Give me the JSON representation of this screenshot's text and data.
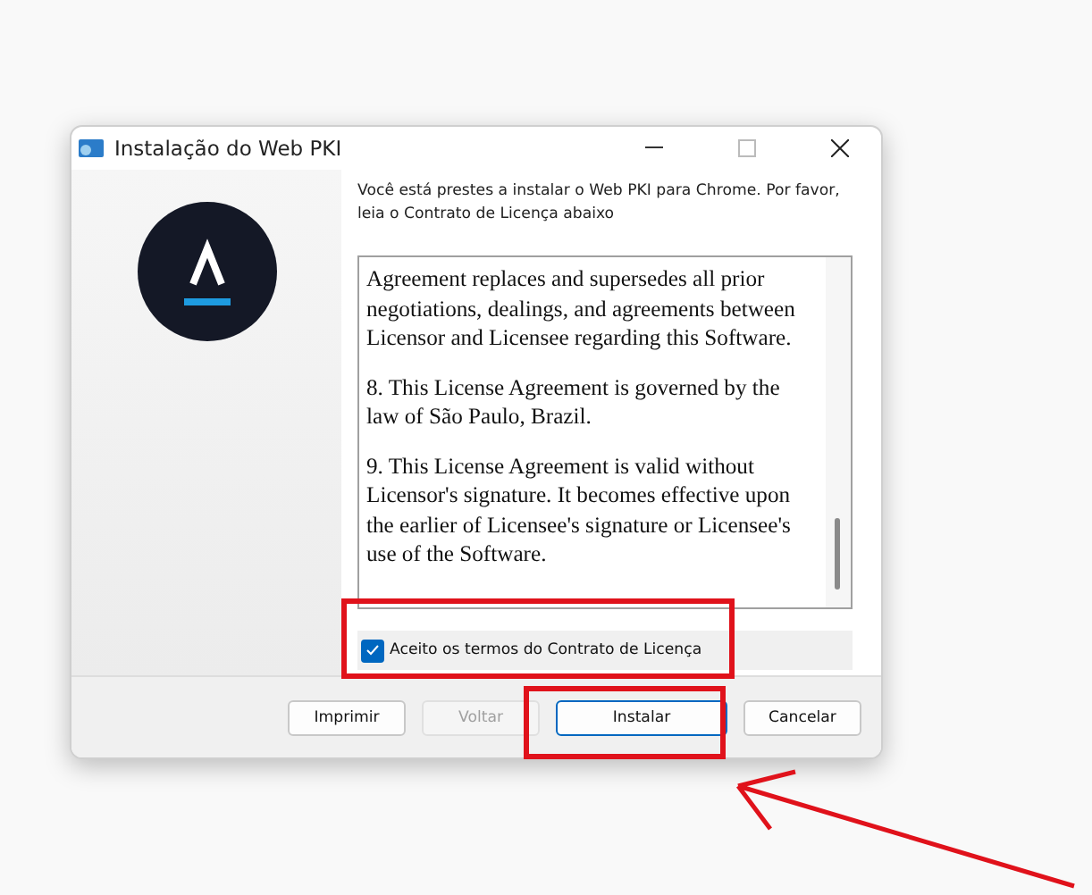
{
  "window": {
    "title": "Instalação do Web PKI"
  },
  "intro": "Você está prestes a instalar o Web PKI para Chrome. Por favor, leia o Contrato de Licença abaixo",
  "license_paragraphs": [
    "Agreement replaces and supersedes all prior negotiations, dealings, and agreements between Licensor and Licensee regarding this Software.",
    "8. This License Agreement is governed by the law of São Paulo, Brazil.",
    "9. This License Agreement is valid without Licensor's signature. It becomes effective upon the earlier of Licensee's signature or Licensee's use of the Software."
  ],
  "accept": {
    "label": "Aceito os termos do Contrato de Licença",
    "checked": true
  },
  "buttons": [
    {
      "label": "Imprimir",
      "disabled": false,
      "focused": false
    },
    {
      "label": "Voltar",
      "disabled": true,
      "focused": false
    },
    {
      "label": "Instalar",
      "disabled": false,
      "focused": true
    },
    {
      "label": "Cancelar",
      "disabled": false,
      "focused": false
    }
  ]
}
